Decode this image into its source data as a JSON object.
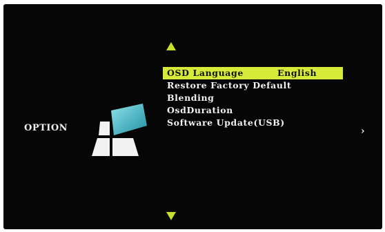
{
  "screen": {
    "title": "OPTION",
    "logo_icon": "option-cube-icon",
    "menu": [
      {
        "label": "OSD Language",
        "value": "English",
        "selected": true
      },
      {
        "label": "Restore Factory Default",
        "value": "",
        "selected": false
      },
      {
        "label": "Blending",
        "value": "",
        "selected": false
      },
      {
        "label": "OsdDuration",
        "value": "",
        "selected": false
      },
      {
        "label": "Software Update(USB)",
        "value": "",
        "selected": false
      }
    ],
    "nav": {
      "up_icon": "triangle-up-icon",
      "down_icon": "triangle-down-icon",
      "next_glyph": "›",
      "next_icon": "chevron-right-icon"
    },
    "colors": {
      "background": "#060606",
      "highlight": "#d6ea3a",
      "arrow": "#c8de2e",
      "text": "#f2f2f2",
      "logo_accent": "#3fb6c6"
    }
  }
}
